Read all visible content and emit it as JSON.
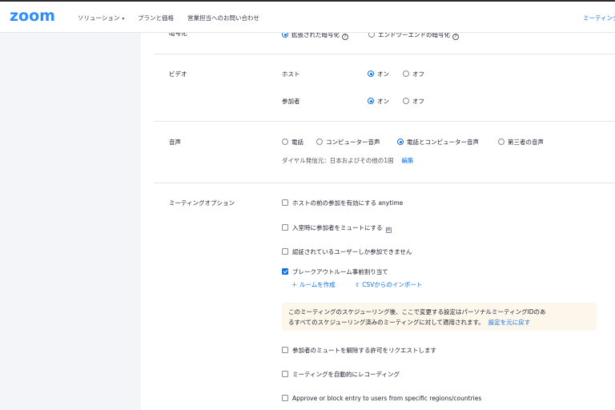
{
  "header": {
    "logo": "zoom",
    "nav": [
      {
        "label": "ソリューション",
        "caret": "▾"
      },
      {
        "label": "プランと価格"
      },
      {
        "label": "営業担当へのお問い合わせ"
      }
    ],
    "right_link": "ミーティング"
  },
  "encryption": {
    "label": "暗号化",
    "options": [
      "拡張された暗号化",
      "エンドツーエンドの暗号化"
    ],
    "selected": 0
  },
  "video": {
    "label": "ビデオ",
    "host": {
      "label": "ホスト",
      "on": "オン",
      "off": "オフ",
      "selected": "on"
    },
    "participants": {
      "label": "参加者",
      "on": "オン",
      "off": "オフ",
      "selected": "on"
    }
  },
  "audio": {
    "label": "音声",
    "options": [
      "電話",
      "コンピューター音声",
      "電話とコンピューター音声",
      "第三者の音声"
    ],
    "selected": 2,
    "dial_from": "ダイヤル発信元：日本およびその他の1国",
    "edit_link": "編集"
  },
  "meeting_options": {
    "label": "ミーティングオプション",
    "items": [
      {
        "label": "ホストの前の参加を有効にする anytime",
        "checked": false
      },
      {
        "label": "入室時に参加者をミュートにする",
        "checked": false
      },
      {
        "label": "認証されているユーザーしか参加できません",
        "checked": false
      },
      {
        "label": "ブレークアウトルーム事前割り当て",
        "checked": true
      }
    ],
    "create_room": "＋ ルームを作成",
    "csv_import": "CSVからのインポート",
    "notice_line1": "このミーティングのスケジューリング後、ここで変更する設定はパーソナルミーティングIDのあ",
    "notice_line2": "るすべてのスケジューリング済みのミーティングに対して適用されます。",
    "restore_link": "設定を元に戻す",
    "items2": [
      {
        "label": "参加者のミュートを解除する許可をリクエストします",
        "checked": false
      },
      {
        "label": "ミーティングを自動的にレコーディング",
        "checked": false
      },
      {
        "label": "Approve or block entry to users from specific regions/countries",
        "checked": false
      }
    ]
  },
  "colors": {
    "accent": "#0e72ed",
    "logo": "#2d8cff",
    "notice_bg": "#fdf6ea",
    "sidebar_bg": "#f4f5f8"
  }
}
